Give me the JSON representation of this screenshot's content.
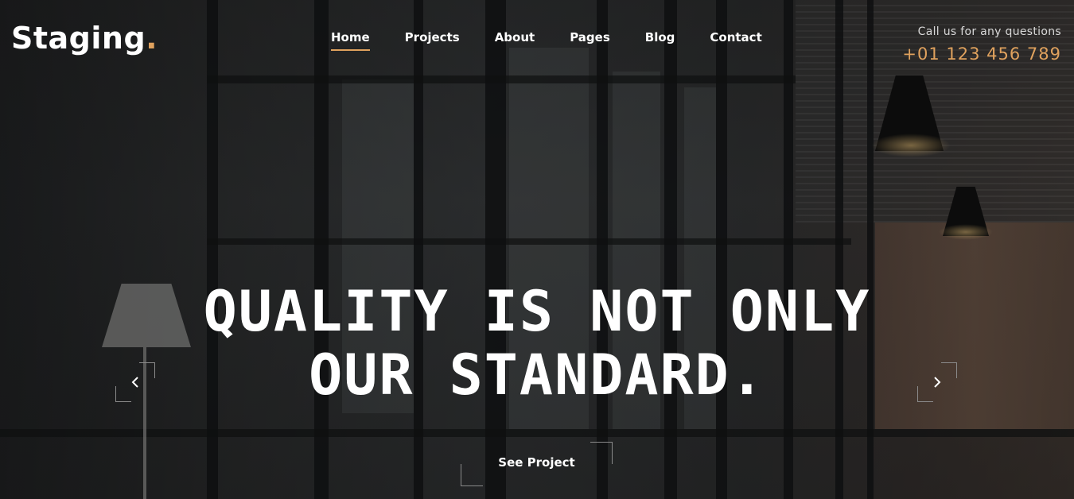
{
  "brand": {
    "name": "Staging",
    "dot": "."
  },
  "nav": {
    "items": [
      {
        "label": "Home",
        "active": true
      },
      {
        "label": "Projects",
        "active": false
      },
      {
        "label": "About",
        "active": false
      },
      {
        "label": "Pages",
        "active": false
      },
      {
        "label": "Blog",
        "active": false
      },
      {
        "label": "Contact",
        "active": false
      }
    ]
  },
  "contact": {
    "label": "Call us for any questions",
    "phone": "+01 123 456 789"
  },
  "hero": {
    "headline_line1": "QUALITY IS NOT ONLY",
    "headline_line2": "OUR STANDARD.",
    "cta_label": "See Project",
    "prev_icon": "chevron-left-icon",
    "next_icon": "chevron-right-icon"
  },
  "colors": {
    "accent": "#e0a25e",
    "text": "#ffffff",
    "overlay": "#1a1a1a"
  }
}
